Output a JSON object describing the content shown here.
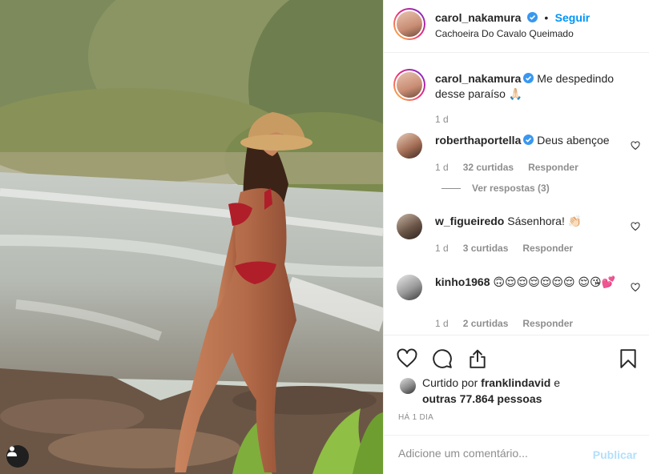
{
  "post": {
    "author": "carol_nakamura",
    "follow_label": "Seguir",
    "dot": "•",
    "location": "Cachoeira Do Cavalo Queimado"
  },
  "caption": {
    "username": "carol_nakamura",
    "text": "Me despedindo desse paraíso 🙏🏻",
    "time": "1 d"
  },
  "comments": [
    {
      "username": "roberthaportella",
      "verified": true,
      "text": "Deus abençoe",
      "time": "1 d",
      "likes": "32 curtidas",
      "reply": "Responder",
      "view_replies": "Ver respostas (3)"
    },
    {
      "username": "w_figueiredo",
      "verified": false,
      "text": "Sásenhora! 👏🏻",
      "time": "1 d",
      "likes": "3 curtidas",
      "reply": "Responder"
    },
    {
      "username": "kinho1968",
      "verified": false,
      "text": "🙃😌😌😌😌😌😌 😌😘💕",
      "time": "1 d",
      "likes": "2 curtidas",
      "reply": "Responder"
    }
  ],
  "likes": {
    "prefix": "Curtido por",
    "user": "franklindavid",
    "conj": "e",
    "others": "outras 77.864 pessoas"
  },
  "posted": "HÁ 1 DIA",
  "comment_box": {
    "placeholder": "Adicione um comentário...",
    "publish": "Publicar"
  },
  "colors": {
    "accent": "#0095f6",
    "publish_disabled": "#b2dffc",
    "muted": "#8e8e8e"
  },
  "icons": [
    "heart-icon",
    "comment-icon",
    "share-icon",
    "bookmark-icon",
    "verified-icon",
    "user-tag-icon"
  ]
}
